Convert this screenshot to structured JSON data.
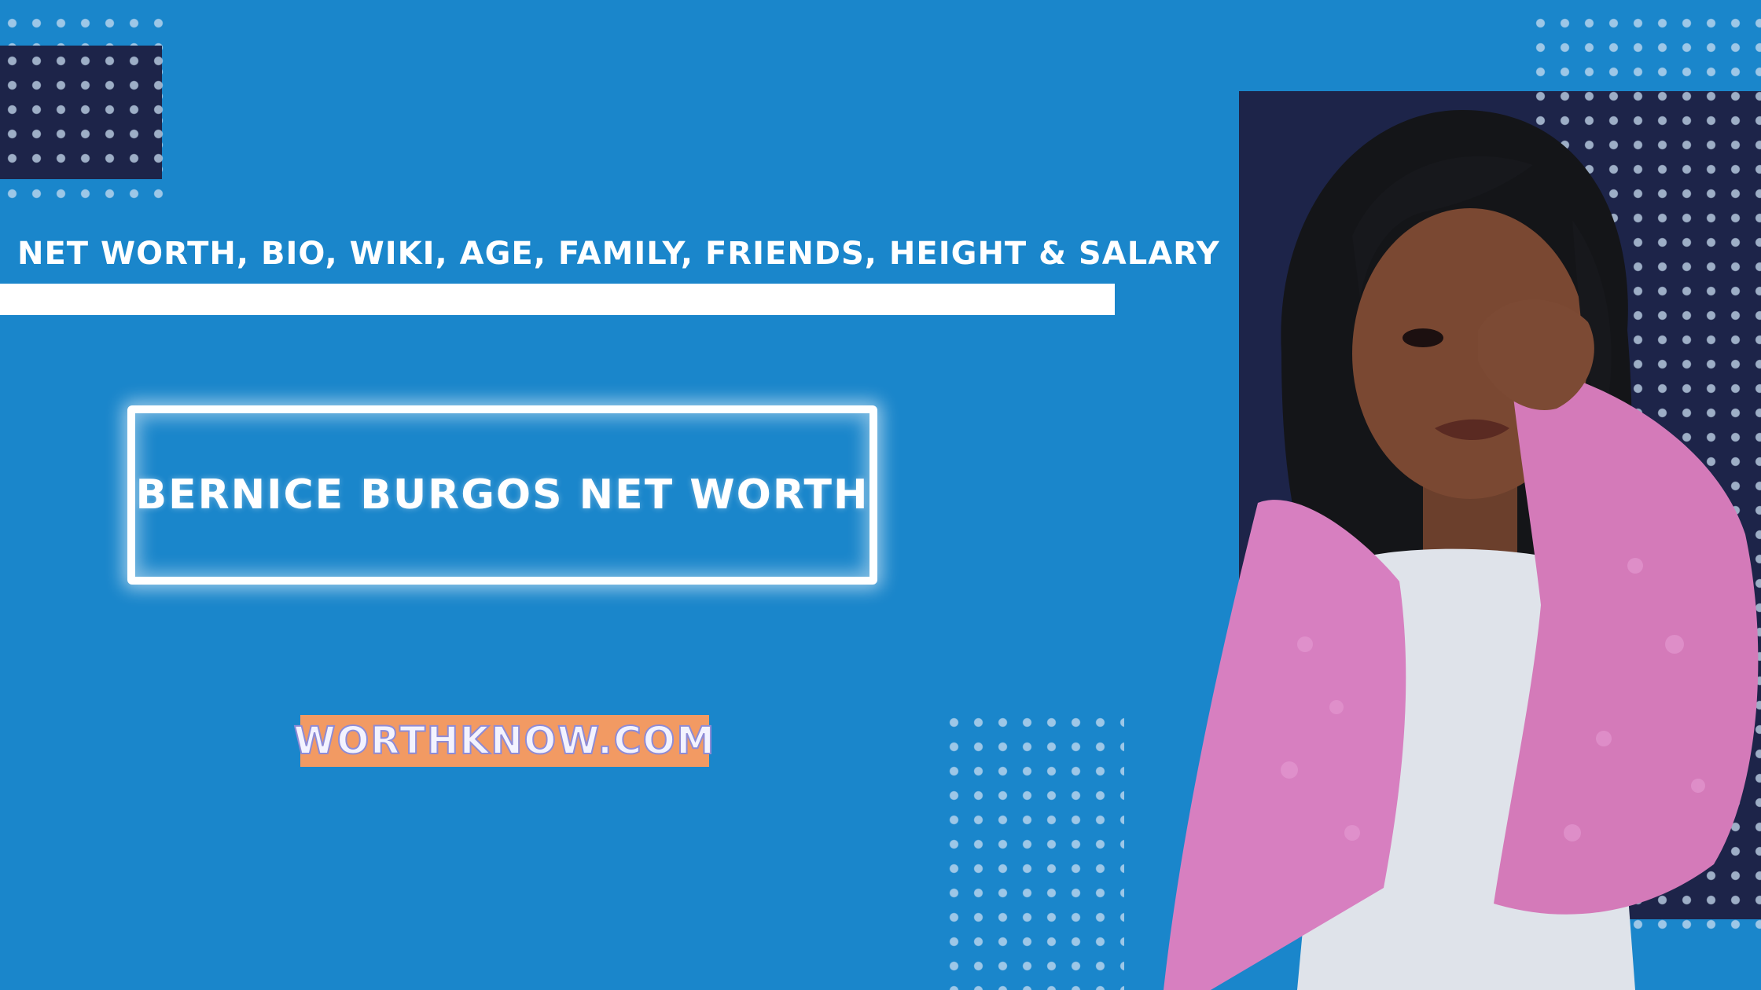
{
  "header": {
    "subtitle": "NET WORTH, BIO, WIKI, AGE, FAMILY, FRIENDS, HEIGHT & SALARY"
  },
  "main": {
    "title": "BERNICE BURGOS NET WORTH"
  },
  "brand": {
    "site": "WORTHKNOW.COM"
  },
  "colors": {
    "background": "#1a86cb",
    "dark_block": "#1d2449",
    "accent_orange": "#f29a63",
    "jacket_pink": "#d77fc0"
  },
  "photo": {
    "subject_icon": "person-portrait"
  }
}
